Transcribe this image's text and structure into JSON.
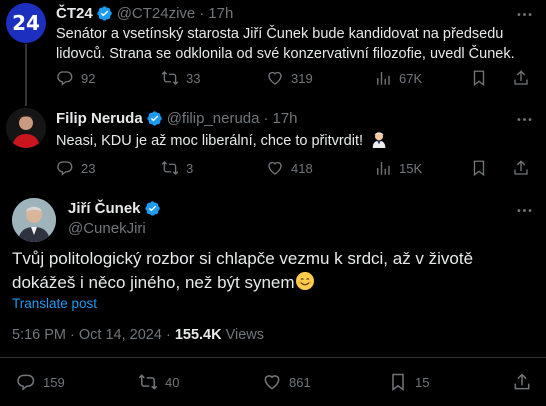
{
  "tweets": [
    {
      "name": "ČT24",
      "handle": "@CT24zive",
      "dot": "·",
      "time": "17h",
      "avatar_text": "24",
      "text": "Senátor a vsetínský starosta Jiří Čunek bude kandidovat na předsedu lidovců. Strana se odklonila od své konzervativní filozofie, uvedl Čunek.",
      "replies": "92",
      "reposts": "33",
      "likes": "319",
      "views": "67K"
    },
    {
      "name": "Filip Neruda",
      "handle": "@filip_neruda",
      "dot": "·",
      "time": "17h",
      "text": "Neasi, KDU je až moc liberální, chce to přitvrdit!",
      "replies": "23",
      "reposts": "3",
      "likes": "418",
      "views": "15K"
    }
  ],
  "main": {
    "name": "Jiří Čunek",
    "handle": "@CunekJiri",
    "text": "Tvůj politologický rozbor si chlapče vezmu k srdci, až v životě dokážeš i něco jiného, než být synem",
    "translate": "Translate post",
    "timestamp": "5:16 PM · Oct 14, 2024 · ",
    "views_count": "155.4K",
    "views_label": " Views",
    "replies": "159",
    "reposts": "40",
    "likes": "861",
    "bookmarks": "15"
  },
  "colors": {
    "background": "#000000",
    "text": "#e7e9ea",
    "muted": "#71767b",
    "accent": "#1d9bf0",
    "verified": "#1d9bf0",
    "ct24_red": "#e3051b"
  }
}
